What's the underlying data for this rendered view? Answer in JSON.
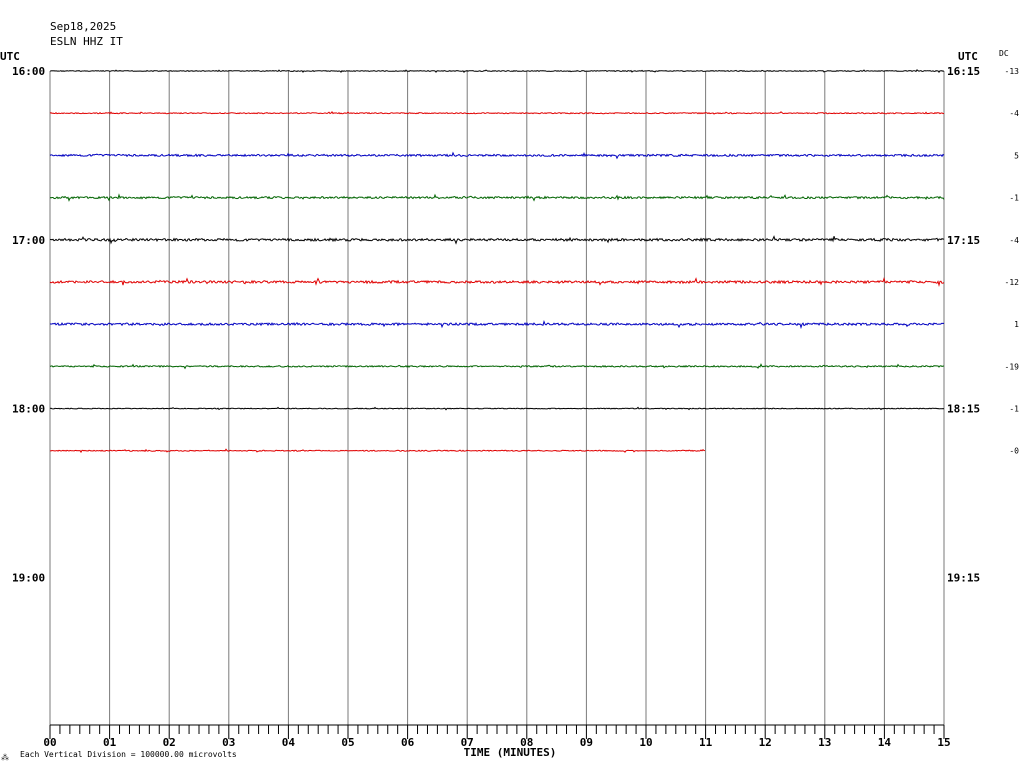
{
  "header": {
    "date": "Sep18,2025",
    "station": "ESLN HHZ IT",
    "utc_left": "UTC",
    "utc_right": "UTC",
    "dc_label": "DC"
  },
  "footer": {
    "note": "Each Vertical Division = 100000.00 microvolts",
    "corner_mark": "⁂"
  },
  "chart_data": {
    "type": "line",
    "title": "",
    "xlabel": "TIME (MINUTES)",
    "ylabel": "",
    "xlim": [
      0,
      15
    ],
    "x_ticks": [
      "00",
      "01",
      "02",
      "03",
      "04",
      "05",
      "06",
      "07",
      "08",
      "09",
      "10",
      "11",
      "12",
      "13",
      "14",
      "15"
    ],
    "left_time_labels": [
      "16:00",
      "17:00",
      "18:00",
      "19:00"
    ],
    "right_time_labels": [
      "16:15",
      "17:15",
      "18:15",
      "19:15"
    ],
    "grid": true,
    "rows": 16,
    "trace_colors": [
      "#000000",
      "#e00000",
      "#0000c0",
      "#006400"
    ],
    "series": [
      {
        "row": 0,
        "color": "#000000",
        "dc": "-13",
        "x_end": 15,
        "noise": 0.4
      },
      {
        "row": 1,
        "color": "#e00000",
        "dc": "-4",
        "x_end": 15,
        "noise": 0.5
      },
      {
        "row": 2,
        "color": "#0000c0",
        "dc": "5",
        "x_end": 15,
        "noise": 1.0
      },
      {
        "row": 3,
        "color": "#006400",
        "dc": "-1",
        "x_end": 15,
        "noise": 1.0
      },
      {
        "row": 4,
        "color": "#000000",
        "dc": "-4",
        "x_end": 15,
        "noise": 1.2
      },
      {
        "row": 5,
        "color": "#e00000",
        "dc": "-12",
        "x_end": 15,
        "noise": 1.2
      },
      {
        "row": 6,
        "color": "#0000c0",
        "dc": "1",
        "x_end": 15,
        "noise": 1.1
      },
      {
        "row": 7,
        "color": "#006400",
        "dc": "-19",
        "x_end": 15,
        "noise": 0.7
      },
      {
        "row": 8,
        "color": "#000000",
        "dc": "-1",
        "x_end": 15,
        "noise": 0.4
      },
      {
        "row": 9,
        "color": "#e00000",
        "dc": "-0",
        "x_end": 11,
        "noise": 0.5
      }
    ]
  }
}
